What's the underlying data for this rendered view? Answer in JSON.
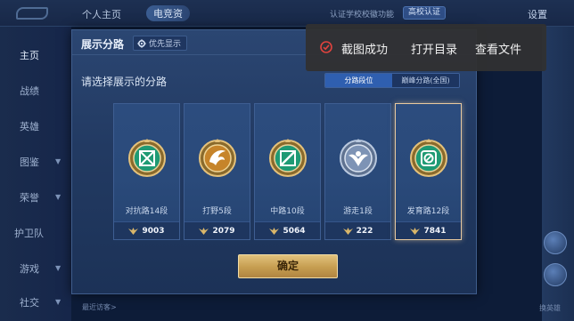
{
  "topbar": {
    "tab_personal": "个人主页",
    "tab_battle": "电竞资",
    "right_text": "认证学校校徽功能",
    "campus_badge": "高校认证",
    "settings": "设置"
  },
  "sidebar": {
    "items": [
      "主页",
      "战绩",
      "英雄",
      "图鉴",
      "荣誉",
      "护卫队",
      "游戏",
      "社交"
    ]
  },
  "bottom": {
    "recent_visitors": "最近访客>",
    "hero_btn": "换英雄"
  },
  "dialog": {
    "title": "展示分路",
    "priority_label": "优先显示",
    "prompt": "请选择展示的分路",
    "seg_tabs": [
      "分路段位",
      "巅峰分路(全国)"
    ],
    "lanes": [
      {
        "label": "对抗路14段",
        "score": "9003",
        "selected": false,
        "color": "#2fbf8f"
      },
      {
        "label": "打野5段",
        "score": "2079",
        "selected": false,
        "color": "#d48d2a"
      },
      {
        "label": "中路10段",
        "score": "5064",
        "selected": false,
        "color": "#2fbf8f"
      },
      {
        "label": "游走1段",
        "score": "222",
        "selected": false,
        "color": "#8aa4c8"
      },
      {
        "label": "发育路12段",
        "score": "7841",
        "selected": true,
        "color": "#2fbf8f"
      }
    ],
    "confirm": "确定"
  },
  "toast": {
    "success": "截图成功",
    "open_dir": "打开目录",
    "view_file": "查看文件",
    "accent": "#e0433e"
  }
}
